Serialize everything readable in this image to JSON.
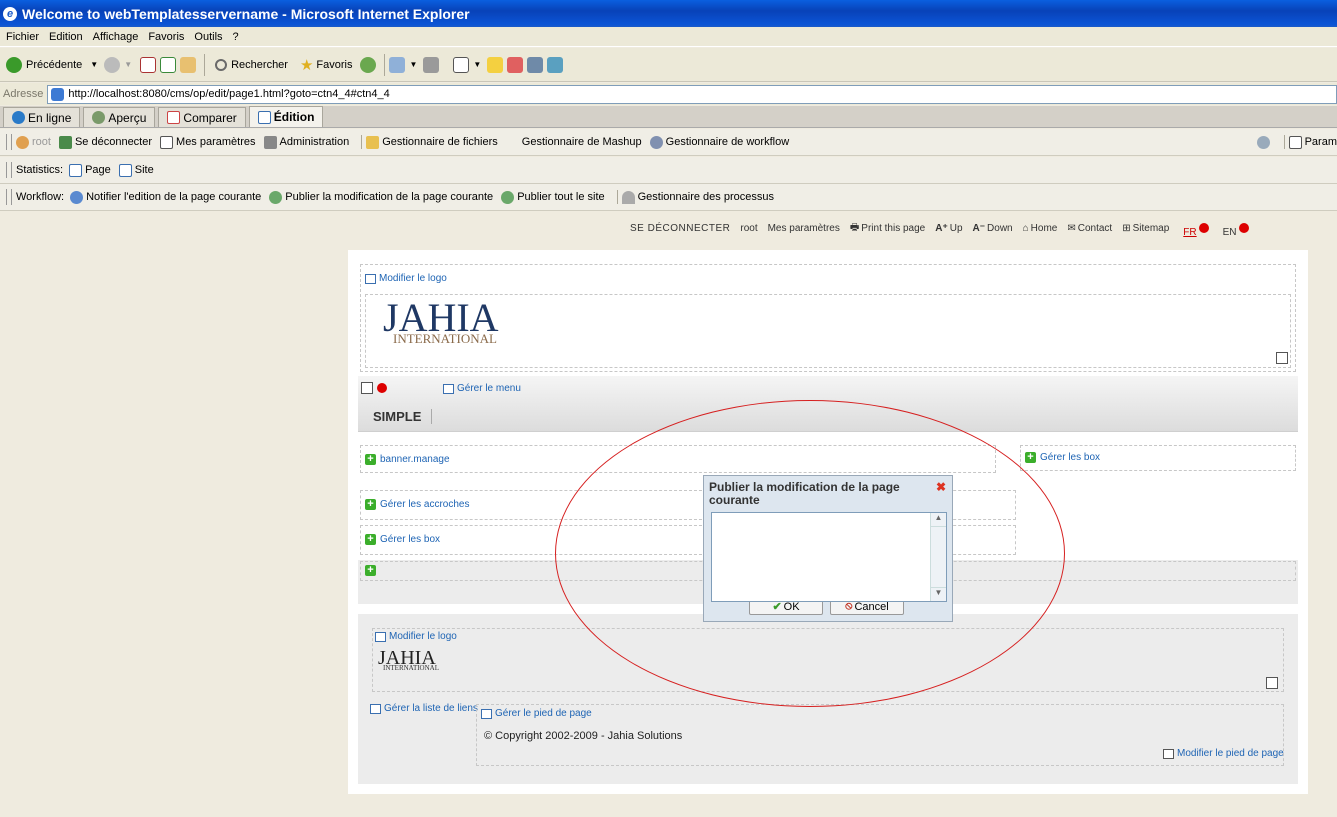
{
  "window": {
    "title": "Welcome to webTemplatesservername - Microsoft Internet Explorer"
  },
  "menubar": [
    "Fichier",
    "Edition",
    "Affichage",
    "Favoris",
    "Outils",
    "?"
  ],
  "toolbar": {
    "back": "Précédente",
    "search": "Rechercher",
    "favorites": "Favoris"
  },
  "address": {
    "label": "Adresse",
    "url": "http://localhost:8080/cms/op/edit/page1.html?goto=ctn4_4#ctn4_4"
  },
  "modetabs": [
    "En ligne",
    "Aperçu",
    "Comparer",
    "Édition"
  ],
  "userbar": {
    "user": "root",
    "logout": "Se déconnecter",
    "settings": "Mes paramètres",
    "admin": "Administration",
    "files": "Gestionnaire de fichiers",
    "mashup": "Gestionnaire de Mashup",
    "workflow": "Gestionnaire de workflow",
    "right": "Param"
  },
  "statsbar": {
    "label": "Statistics:",
    "page": "Page",
    "site": "Site"
  },
  "workflowbar": {
    "label": "Workflow:",
    "notify": "Notifier l'edition de la page courante",
    "publish_page": "Publier la modification de la page courante",
    "publish_site": "Publier tout le site",
    "processes": "Gestionnaire des processus"
  },
  "topnav": {
    "logout": "SE DÉCONNECTER",
    "user": "root",
    "settings": "Mes paramètres",
    "print": "Print this page",
    "up": "Up",
    "down": "Down",
    "home": "Home",
    "contact": "Contact",
    "sitemap": "Sitemap",
    "lang_fr": "FR",
    "lang_en": "EN"
  },
  "header": {
    "edit_logo": "Modifier le logo",
    "logo_main": "JAHIA",
    "logo_sub": "INTERNATIONAL"
  },
  "menu": {
    "manage": "Gérer le menu",
    "item": "SIMPLE"
  },
  "content": {
    "banner": "banner.manage",
    "boxes_right": "Gérer les box",
    "hooks": "Gérer les accroches",
    "boxes": "Gérer les box"
  },
  "footer": {
    "edit_logo": "Modifier le logo",
    "logo_main": "JAHIA",
    "logo_sub": "INTERNATIONAL",
    "links": "Gérer la liste de liens",
    "manage_footer": "Gérer le pied de page",
    "copyright": "© Copyright 2002-2009 - Jahia Solutions",
    "edit_footer": "Modifier le pied de page"
  },
  "dialog": {
    "title": "Publier la modification de la page courante",
    "ok": "OK",
    "cancel": "Cancel"
  },
  "colors": {
    "titlebar": "#0a5fe0",
    "link": "#1e64b4",
    "annotation": "#d62020"
  }
}
